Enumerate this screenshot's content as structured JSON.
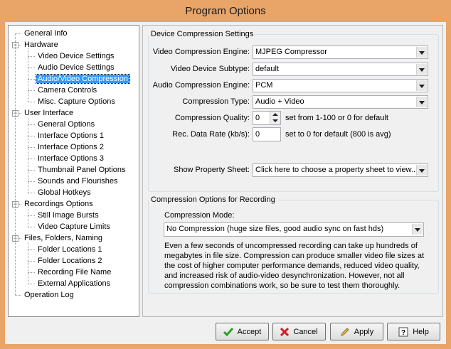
{
  "window": {
    "title": "Program Options"
  },
  "tree": {
    "items": [
      {
        "label": "General Info"
      },
      {
        "label": "Hardware"
      },
      {
        "label": "Video Device Settings"
      },
      {
        "label": "Audio Device Settings"
      },
      {
        "label": "Audio/Video Compression"
      },
      {
        "label": "Camera Controls"
      },
      {
        "label": "Misc. Capture Options"
      },
      {
        "label": "User Interface"
      },
      {
        "label": "General Options"
      },
      {
        "label": "Interface Options 1"
      },
      {
        "label": "Interface Options 2"
      },
      {
        "label": "Interface Options 3"
      },
      {
        "label": "Thumbnail Panel Options"
      },
      {
        "label": "Sounds and Flourishes"
      },
      {
        "label": "Global Hotkeys"
      },
      {
        "label": "Recordings Options"
      },
      {
        "label": "Still Image Bursts"
      },
      {
        "label": "Video Capture Limits"
      },
      {
        "label": "Files, Folders, Naming"
      },
      {
        "label": "Folder Locations 1"
      },
      {
        "label": "Folder Locations 2"
      },
      {
        "label": "Recording File Name"
      },
      {
        "label": "External Applications"
      },
      {
        "label": "Operation Log"
      }
    ],
    "selected": "Audio/Video Compression"
  },
  "device": {
    "legend": "Device Compression Settings",
    "video_engine_label": "Video Compression Engine:",
    "video_engine_value": "MJPEG Compressor",
    "video_subtype_label": "Video Device Subtype:",
    "video_subtype_value": "default",
    "audio_engine_label": "Audio Compression Engine:",
    "audio_engine_value": "PCM",
    "compression_type_label": "Compression Type:",
    "compression_type_value": "Audio + Video",
    "quality_label": "Compression Quality:",
    "quality_value": "0",
    "quality_hint": "set from 1-100 or 0 for default",
    "datarate_label": "Rec. Data Rate (kb/s):",
    "datarate_value": "0",
    "datarate_hint": "set to 0 for default (800 is avg)",
    "property_label": "Show Property Sheet:",
    "property_value": "Click here to choose a property sheet to view..."
  },
  "recording": {
    "legend": "Compression Options for Recording",
    "mode_label": "Compression Mode:",
    "mode_value": "No Compression (huge size files, good audio sync on fast hds)",
    "description": "Even a few seconds of uncompressed recording can take up hundreds of megabytes in file size.  Compression can produce smaller video file sizes at the cost of higher computer performance demands, reduced video quality, and increased risk of audio-video desynchronization.  However, not all compression combinations work, so be sure to test them thoroughly."
  },
  "buttons": {
    "accept": "Accept",
    "cancel": "Cancel",
    "apply": "Apply",
    "help": "Help"
  },
  "colors": {
    "frame": "#e9a468",
    "selection": "#3399ff",
    "client": "#f0f0f0"
  }
}
